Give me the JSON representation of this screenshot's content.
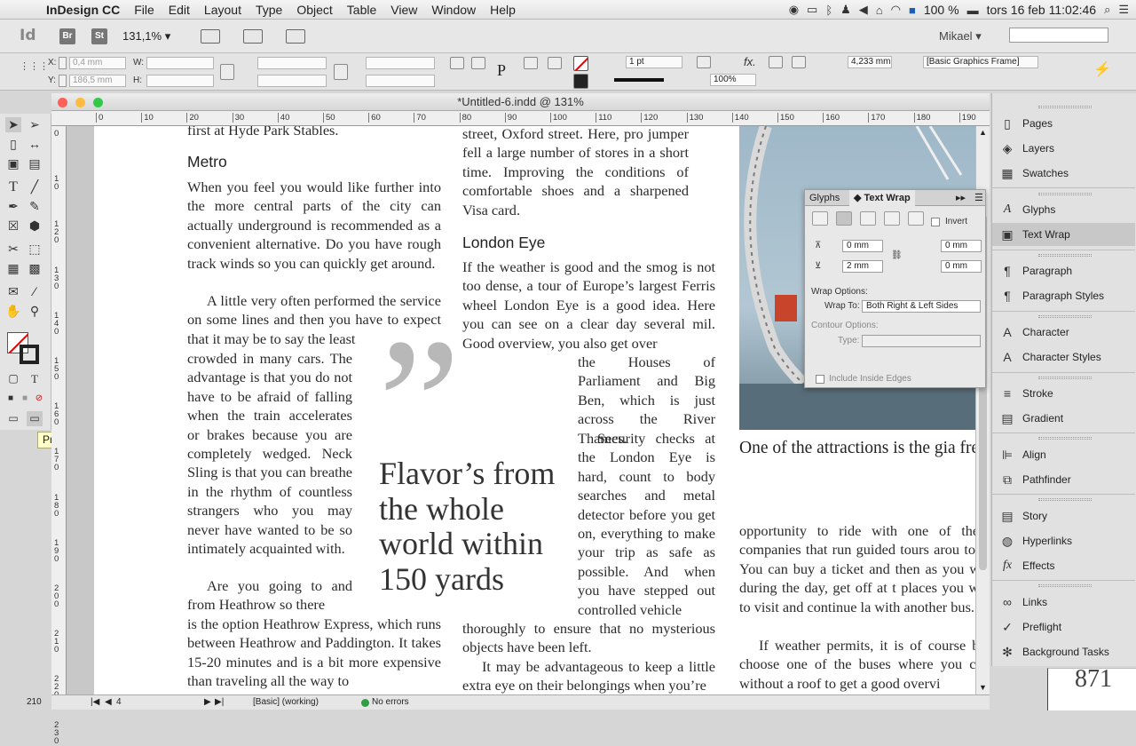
{
  "menubar": {
    "items": [
      "InDesign CC",
      "File",
      "Edit",
      "Layout",
      "Type",
      "Object",
      "Table",
      "View",
      "Window",
      "Help"
    ],
    "battery": "100 %",
    "datetime": "tors 16 feb  11:02:46"
  },
  "appbar": {
    "logo": "Id",
    "br": "Br",
    "st": "St",
    "zoom": "131,1%",
    "user": "Mikael",
    "search_placeholder": ""
  },
  "control": {
    "x_label": "X:",
    "x_value": "0,4 mm",
    "y_label": "Y:",
    "y_value": "186,5 mm",
    "w_label": "W:",
    "h_label": "H:",
    "stroke_weight": "1 pt",
    "opacity": "100%",
    "offset": "4,233 mm",
    "frame_style": "[Basic Graphics Frame]"
  },
  "document": {
    "title": "*Untitled-6.indd @ 131%",
    "hruler": [
      "0",
      "10",
      "20",
      "30",
      "40",
      "50",
      "60",
      "70",
      "80",
      "90",
      "100",
      "110",
      "120",
      "130",
      "140",
      "150",
      "160",
      "170",
      "180",
      "190"
    ],
    "vruler": [
      "0",
      "1 0",
      "1 2 0",
      "1 3 0",
      "1 4 0",
      "1 5 0",
      "1 6 0",
      "1 7 0",
      "1 8 0",
      "1 9 0",
      "2 0 0",
      "2 1 0",
      "2 2 0",
      "2 3 0"
    ],
    "col1": {
      "top_line": "first at Hyde Park Stables.",
      "heading": "Metro",
      "p1": "When you feel you would like further into the more central parts of the city can actually underground is recommended as a convenient alternative. Do you have rough track winds so you can quickly get around.",
      "p2": "A little very often performed the service on some lines and then you have to expect that it may be to say the least",
      "p2b": "crowded in many cars. The advantage is that you do not have to be afraid of falling when the train accelerates or brakes because you are completely wedged. Neck Sling is that you can breathe in the rhythm of countless strangers who you may never have wanted to be so intimately acquainted with.",
      "p3a": "Are you going to and from Heathrow so there",
      "p3b": "is the option Heathrow Express, which runs between Heathrow and Paddington. It takes 15-20 minutes and is a bit more expensive than traveling all the way to"
    },
    "col2": {
      "p0": "street, Oxford street. Here, pro jumper fell a large number of stores in a short time. Improving the conditions of comfortable shoes and a sharpened Visa card.",
      "heading": "London Eye",
      "p1": "If the weather is good and the smog is not too dense, a tour of Europe’s largest Ferris wheel London Eye is a good idea. Here you can see on a clear day several mil. Good overview, you also get over",
      "p1b": "the Houses of Parliament and Big Ben, which is just across the River Thames.",
      "p2": "Security checks at the London Eye is hard, count to body searches and metal detector before you get on, everything to make your trip as safe as possible. And when you have stepped out controlled vehicle",
      "p2b": "thoroughly to ensure that no mysterious objects have been left.",
      "p3": "It may be advantageous to keep a little extra eye on their belongings when you’re"
    },
    "pullquote": "Flavor’s from the whole world within 150 yards",
    "quote_mark": "”",
    "caption": "One of the attractions is the gia freeimages.co.uk",
    "col3": {
      "p1": "opportunity to ride with one of the b companies that run guided tours arou town. You can buy a ticket and then as you wish during the day, get off at t places you want to visit and continue la with another bus.",
      "p2": "If weather permits, it is of course b to choose one of the buses where you c sit without a roof to get a good overvi"
    },
    "status": {
      "zoom": "210",
      "page": "4",
      "style": "[Basic] (working)",
      "errors": "No errors"
    }
  },
  "tooltip": "Preview (W)",
  "textwrap": {
    "tabs": [
      "Glyphs",
      "Text Wrap"
    ],
    "invert": "Invert",
    "top": "0 mm",
    "bottom": "2 mm",
    "left": "0 mm",
    "right": "0 mm",
    "wrap_options": "Wrap Options:",
    "wrap_to_label": "Wrap To:",
    "wrap_to": "Both Right & Left Sides",
    "contour_options": "Contour Options:",
    "type_label": "Type:",
    "include_inside": "Include Inside Edges"
  },
  "panels": [
    {
      "label": "Pages",
      "icon": "pages-icon"
    },
    {
      "label": "Layers",
      "icon": "layers-icon"
    },
    {
      "label": "Swatches",
      "icon": "swatches-icon"
    },
    {
      "label": "Glyphs",
      "icon": "glyphs-icon"
    },
    {
      "label": "Text Wrap",
      "icon": "text-wrap-icon"
    },
    {
      "label": "Paragraph",
      "icon": "paragraph-icon"
    },
    {
      "label": "Paragraph Styles",
      "icon": "paragraph-styles-icon"
    },
    {
      "label": "Character",
      "icon": "character-icon"
    },
    {
      "label": "Character Styles",
      "icon": "character-styles-icon"
    },
    {
      "label": "Stroke",
      "icon": "stroke-icon"
    },
    {
      "label": "Gradient",
      "icon": "gradient-icon"
    },
    {
      "label": "Align",
      "icon": "align-icon"
    },
    {
      "label": "Pathfinder",
      "icon": "pathfinder-icon"
    },
    {
      "label": "Story",
      "icon": "story-icon"
    },
    {
      "label": "Hyperlinks",
      "icon": "hyperlinks-icon"
    },
    {
      "label": "Effects",
      "icon": "effects-icon"
    },
    {
      "label": "Links",
      "icon": "links-icon"
    },
    {
      "label": "Preflight",
      "icon": "preflight-icon"
    },
    {
      "label": "Background Tasks",
      "icon": "background-tasks-icon"
    }
  ],
  "page_number": "871"
}
